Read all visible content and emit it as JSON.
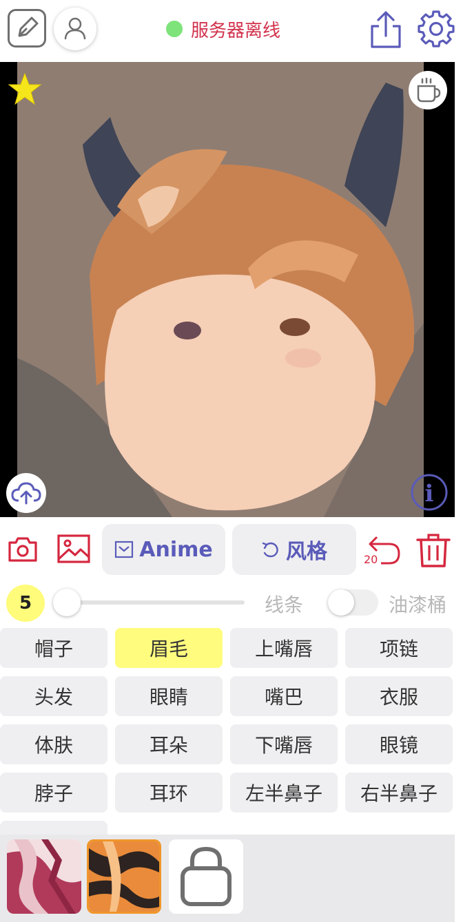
{
  "header": {
    "status_text": "服务器离线",
    "status_color": "#d2324d",
    "status_dot_color": "#7ee37a",
    "icons": [
      "pen-edit-icon",
      "user-icon",
      "share-upload-icon",
      "gear-icon"
    ]
  },
  "canvas": {
    "icons": [
      "star-icon",
      "coffee-cup-icon",
      "cloud-upload-icon",
      "info-icon"
    ]
  },
  "toolbar": {
    "anime_label": "Anime",
    "style_label": "风格",
    "undo_count": "20",
    "accent_color": "#5a5bb9",
    "danger_color": "#d5273f"
  },
  "controls": {
    "brush_size": "5",
    "line_label": "线条",
    "bucket_label": "油漆桶",
    "bucket_enabled": false
  },
  "parts": [
    {
      "label": "帽子",
      "selected": false
    },
    {
      "label": "眉毛",
      "selected": true
    },
    {
      "label": "上嘴唇",
      "selected": false
    },
    {
      "label": "项链",
      "selected": false
    },
    {
      "label": "头发",
      "selected": false
    },
    {
      "label": "眼睛",
      "selected": false
    },
    {
      "label": "嘴巴",
      "selected": false
    },
    {
      "label": "衣服",
      "selected": false
    },
    {
      "label": "体肤",
      "selected": false
    },
    {
      "label": "耳朵",
      "selected": false
    },
    {
      "label": "下嘴唇",
      "selected": false
    },
    {
      "label": "眼镜",
      "selected": false
    },
    {
      "label": "脖子",
      "selected": false
    },
    {
      "label": "耳环",
      "selected": false
    },
    {
      "label": "左半鼻子",
      "selected": false
    },
    {
      "label": "右半鼻子",
      "selected": false
    },
    {
      "label": "",
      "selected": false
    }
  ],
  "styles": [
    {
      "name": "style-thumb-red",
      "selected": false
    },
    {
      "name": "style-thumb-orange",
      "selected": true
    },
    {
      "name": "locked-style",
      "selected": false
    }
  ]
}
